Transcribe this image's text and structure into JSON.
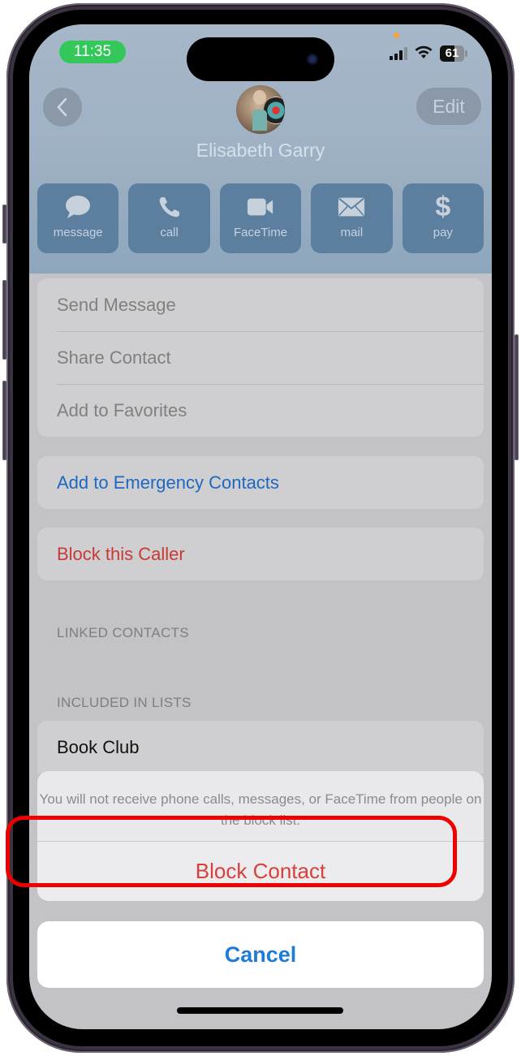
{
  "status_bar": {
    "time": "11:35",
    "battery_percent": "61",
    "battery_level": 0.61,
    "signal_bars": 3,
    "signal_bars_total": 4
  },
  "header": {
    "back_icon": "chevron-left-icon",
    "edit_label": "Edit",
    "contact_name": "Elisabeth Garry"
  },
  "actions": [
    {
      "label": "message",
      "icon": "speech-bubble-icon"
    },
    {
      "label": "call",
      "icon": "phone-icon"
    },
    {
      "label": "FaceTime",
      "icon": "video-camera-icon"
    },
    {
      "label": "mail",
      "icon": "envelope-icon"
    },
    {
      "label": "pay",
      "icon": "dollar-icon"
    }
  ],
  "options_group": [
    {
      "label": "Send Message"
    },
    {
      "label": "Share Contact"
    },
    {
      "label": "Add to Favorites"
    }
  ],
  "emergency": {
    "label": "Add to Emergency Contacts"
  },
  "block_caller": {
    "label": "Block this Caller"
  },
  "sections": {
    "linked_contacts": "LINKED CONTACTS",
    "included_in_lists": "INCLUDED IN LISTS"
  },
  "lists": [
    {
      "label": "Book Club"
    }
  ],
  "action_sheet": {
    "message": "You will not receive phone calls, messages, or FaceTime from people on the block list.",
    "confirm_label": "Block Contact",
    "cancel_label": "Cancel"
  },
  "colors": {
    "accent_blue": "#1e7bd6",
    "destructive_red": "#d9403b",
    "time_pill_green": "#34c759",
    "highlight_ring": "#ee0000"
  }
}
